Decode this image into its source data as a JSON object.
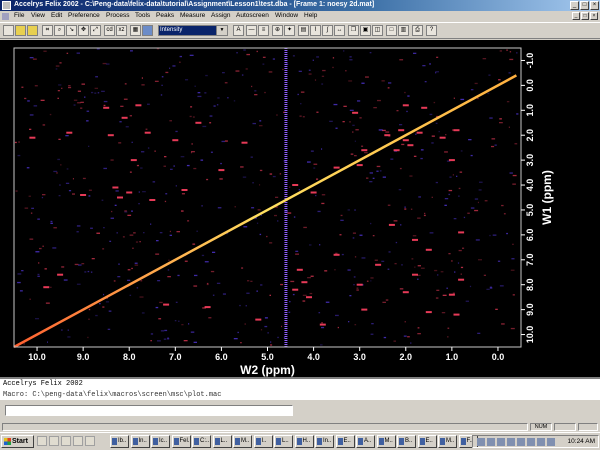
{
  "window": {
    "title": "Accelrys Felix 2002 - C:\\Peng-data\\felix-data\\tutorial\\Assignment\\Lesson1\\test.dba - [Frame 1: noesy 2d.mat]"
  },
  "menu": [
    "File",
    "View",
    "Edit",
    "Preference",
    "Process",
    "Tools",
    "Peaks",
    "Measure",
    "Assign",
    "Autoscreen",
    "Window",
    "Help"
  ],
  "toolbar": {
    "display_mode": "Intensity",
    "small_labels": [
      "cd",
      "xz",
      "A"
    ]
  },
  "plot": {
    "x_axis_label": "W2 (ppm)",
    "y_axis_label": "W1 (ppm)",
    "x_ticks": [
      "10.0",
      "9.0",
      "8.0",
      "7.0",
      "6.0",
      "5.0",
      "4.0",
      "3.0",
      "2.0",
      "1.0",
      "0.0"
    ],
    "y_ticks": [
      "-1.0",
      "0.0",
      "1.0",
      "2.0",
      "3.0",
      "4.0",
      "5.0",
      "6.0",
      "7.0",
      "8.0",
      "9.0",
      "10.0"
    ],
    "colors": {
      "background": "#000000",
      "diagonal": "#ffd040",
      "peak_hot": "#ff4060",
      "peak_cool": "#6040ff"
    }
  },
  "chart_data": {
    "type": "heatmap",
    "title": "",
    "xlabel": "W2 (ppm)",
    "ylabel": "W1 (ppm)",
    "xlim": [
      10.5,
      -0.5
    ],
    "ylim": [
      -1.5,
      10.5
    ],
    "x_tick_values": [
      10,
      9,
      8,
      7,
      6,
      5,
      4,
      3,
      2,
      1,
      0
    ],
    "y_tick_values": [
      -1,
      0,
      1,
      2,
      3,
      4,
      5,
      6,
      7,
      8,
      9,
      10
    ],
    "diagonal": [
      [
        10.5,
        10.5
      ],
      [
        -0.4,
        -0.4
      ]
    ],
    "water_line_ppm": 4.6,
    "cross_peaks": [
      [
        2.0,
        2.2
      ],
      [
        2.1,
        1.8
      ],
      [
        1.9,
        2.4
      ],
      [
        2.2,
        2.6
      ],
      [
        1.7,
        1.9
      ],
      [
        2.4,
        2.0
      ],
      [
        3.0,
        3.2
      ],
      [
        2.9,
        2.6
      ],
      [
        3.5,
        3.3
      ],
      [
        4.0,
        4.3
      ],
      [
        4.4,
        4.0
      ],
      [
        8.2,
        4.5
      ],
      [
        8.0,
        4.3
      ],
      [
        7.9,
        3.0
      ],
      [
        8.4,
        2.0
      ],
      [
        7.6,
        1.9
      ],
      [
        8.1,
        1.3
      ],
      [
        8.5,
        0.9
      ],
      [
        7.8,
        0.8
      ],
      [
        8.3,
        4.1
      ],
      [
        7.5,
        4.6
      ],
      [
        9.0,
        4.4
      ],
      [
        6.8,
        4.2
      ],
      [
        4.4,
        8.2
      ],
      [
        4.2,
        7.9
      ],
      [
        3.0,
        8.0
      ],
      [
        2.0,
        8.3
      ],
      [
        1.8,
        7.6
      ],
      [
        1.0,
        8.4
      ],
      [
        0.8,
        7.8
      ],
      [
        4.1,
        8.5
      ],
      [
        4.3,
        7.4
      ],
      [
        2.9,
        9.0
      ],
      [
        1.5,
        9.1
      ],
      [
        0.9,
        9.2
      ],
      [
        1.2,
        2.1
      ],
      [
        0.9,
        1.8
      ],
      [
        1.6,
        0.9
      ],
      [
        2.0,
        0.8
      ],
      [
        1.0,
        3.0
      ],
      [
        3.1,
        1.1
      ],
      [
        6.5,
        1.5
      ],
      [
        7.0,
        2.2
      ],
      [
        9.3,
        1.9
      ],
      [
        10.1,
        2.1
      ],
      [
        5.5,
        2.3
      ],
      [
        6.0,
        3.4
      ],
      [
        1.8,
        6.2
      ],
      [
        2.3,
        5.6
      ],
      [
        3.5,
        6.8
      ],
      [
        0.8,
        5.9
      ],
      [
        1.5,
        6.6
      ],
      [
        2.6,
        7.2
      ],
      [
        9.8,
        8.1
      ],
      [
        9.5,
        7.6
      ],
      [
        7.2,
        8.8
      ],
      [
        6.3,
        8.9
      ],
      [
        5.2,
        9.4
      ],
      [
        3.8,
        9.6
      ]
    ]
  },
  "console": {
    "line1": "Accelrys Felix 2002",
    "line2": "Macro:  C:\\peng-data\\felix\\macros\\screen\\msc\\plot.mac"
  },
  "statusbar": {
    "num": "NUM"
  },
  "taskbar": {
    "start_label": "Start",
    "tasks": [
      "Ib..",
      "In..",
      "Ic..",
      "Fel..",
      "C:..",
      "L..",
      "M..",
      "I..",
      "L..",
      "H..",
      "In..",
      "E..",
      "A..",
      "M..",
      "B..",
      "E..",
      "M..",
      "F.."
    ],
    "clock": "10:24 AM"
  }
}
